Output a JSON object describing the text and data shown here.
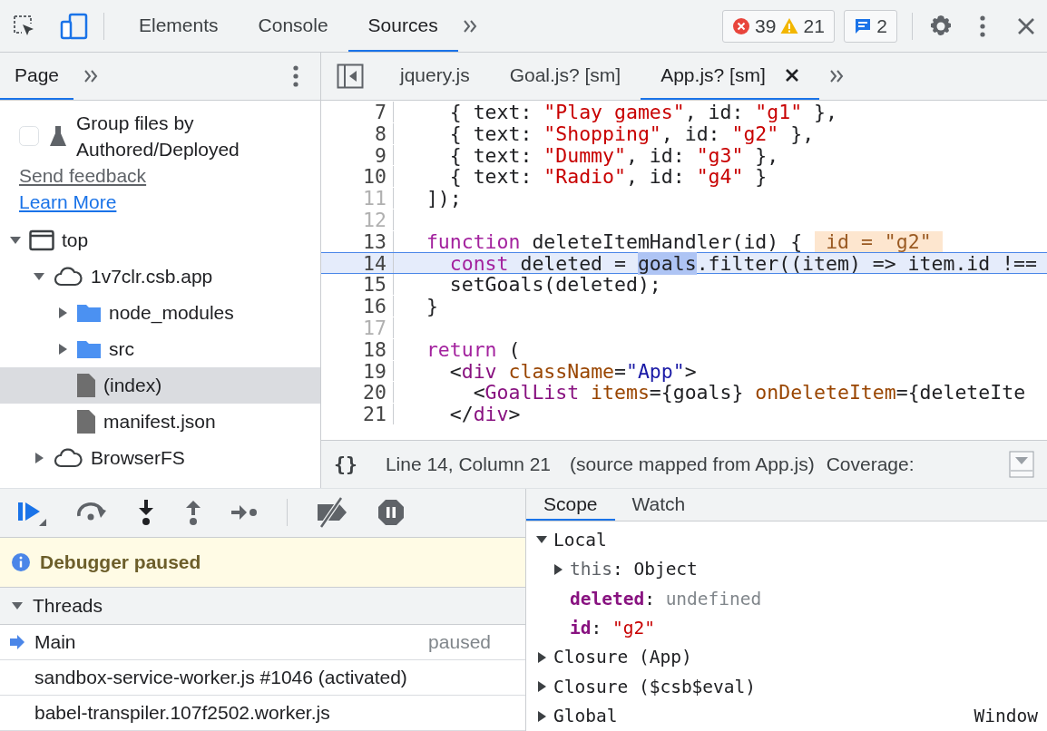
{
  "toolbar": {
    "tabs": [
      {
        "label": "Elements",
        "selected": false
      },
      {
        "label": "Console",
        "selected": false
      },
      {
        "label": "Sources",
        "selected": true
      }
    ],
    "errors": "39",
    "warnings": "21",
    "messages": "2"
  },
  "navigator": {
    "tabs": [
      {
        "label": "Page",
        "selected": true
      }
    ],
    "group_files": {
      "label": "Group files by Authored/Deployed",
      "checked": false
    },
    "send_feedback": "Send feedback",
    "learn_more": "Learn More",
    "tree": [
      {
        "kind": "frame",
        "label": "top",
        "expanded": true,
        "selected": false,
        "children": [
          {
            "kind": "cloud",
            "label": "1v7clr.csb.app",
            "expanded": true,
            "selected": false,
            "children": [
              {
                "kind": "folder",
                "label": "node_modules",
                "expanded": false,
                "selected": false
              },
              {
                "kind": "folder",
                "label": "src",
                "expanded": false,
                "selected": false
              },
              {
                "kind": "file",
                "label": "(index)",
                "selected": true
              },
              {
                "kind": "file",
                "label": "manifest.json",
                "selected": false
              }
            ]
          },
          {
            "kind": "cloud",
            "label": "BrowserFS",
            "expanded": false,
            "selected": false
          }
        ]
      }
    ]
  },
  "editor": {
    "tabs": [
      {
        "label": "jquery.js",
        "selected": false
      },
      {
        "label": "Goal.js? [sm]",
        "selected": false
      },
      {
        "label": "App.js? [sm]",
        "selected": true
      }
    ],
    "lines": [
      {
        "number": "7",
        "dimmed": false,
        "current": false,
        "tokens": [
          {
            "kind": "plain",
            "text": "    { text: "
          },
          {
            "kind": "string",
            "text": "\"Play games\""
          },
          {
            "kind": "plain",
            "text": ", id: "
          },
          {
            "kind": "string",
            "text": "\"g1\""
          },
          {
            "kind": "plain",
            "text": " },"
          }
        ]
      },
      {
        "number": "8",
        "dimmed": false,
        "current": false,
        "tokens": [
          {
            "kind": "plain",
            "text": "    { text: "
          },
          {
            "kind": "string",
            "text": "\"Shopping\""
          },
          {
            "kind": "plain",
            "text": ", id: "
          },
          {
            "kind": "string",
            "text": "\"g2\""
          },
          {
            "kind": "plain",
            "text": " },"
          }
        ]
      },
      {
        "number": "9",
        "dimmed": false,
        "current": false,
        "tokens": [
          {
            "kind": "plain",
            "text": "    { text: "
          },
          {
            "kind": "string",
            "text": "\"Dummy\""
          },
          {
            "kind": "plain",
            "text": ", id: "
          },
          {
            "kind": "string",
            "text": "\"g3\""
          },
          {
            "kind": "plain",
            "text": " },"
          }
        ]
      },
      {
        "number": "10",
        "dimmed": false,
        "current": false,
        "tokens": [
          {
            "kind": "plain",
            "text": "    { text: "
          },
          {
            "kind": "string",
            "text": "\"Radio\""
          },
          {
            "kind": "plain",
            "text": ", id: "
          },
          {
            "kind": "string",
            "text": "\"g4\""
          },
          {
            "kind": "plain",
            "text": " }"
          }
        ]
      },
      {
        "number": "11",
        "dimmed": true,
        "current": false,
        "tokens": [
          {
            "kind": "plain",
            "text": "  ]);"
          }
        ]
      },
      {
        "number": "12",
        "dimmed": true,
        "current": false
      },
      {
        "number": "13",
        "dimmed": false,
        "current": false,
        "tokens": [
          {
            "kind": "keyword",
            "text": "  function"
          },
          {
            "kind": "plain",
            "text": " deleteItemHandler(id) {"
          }
        ],
        "inline_value": "id = \"g2\""
      },
      {
        "number": "14",
        "dimmed": false,
        "current": true,
        "tokens": [
          {
            "kind": "keyword",
            "text": "    const"
          },
          {
            "kind": "plain",
            "text": " deleted = "
          },
          {
            "kind": "match",
            "text": "goals"
          },
          {
            "kind": "plain",
            "text": ".filter((item) => item.id !=="
          }
        ]
      },
      {
        "number": "15",
        "dimmed": false,
        "current": false,
        "tokens": [
          {
            "kind": "plain",
            "text": "    setGoals(deleted);"
          }
        ]
      },
      {
        "number": "16",
        "dimmed": false,
        "current": false,
        "tokens": [
          {
            "kind": "plain",
            "text": "  }"
          }
        ]
      },
      {
        "number": "17",
        "dimmed": true,
        "current": false
      },
      {
        "number": "18",
        "dimmed": false,
        "current": false,
        "tokens": [
          {
            "kind": "keyword",
            "text": "  return"
          },
          {
            "kind": "plain",
            "text": " ("
          }
        ]
      },
      {
        "number": "19",
        "dimmed": false,
        "current": false,
        "tokens": [
          {
            "kind": "plain",
            "text": "    <"
          },
          {
            "kind": "tag",
            "text": "div"
          },
          {
            "kind": "attr",
            "text": " className"
          },
          {
            "kind": "plain",
            "text": "="
          },
          {
            "kind": "attrvalue",
            "text": "\"App\""
          },
          {
            "kind": "plain",
            "text": ">"
          }
        ]
      },
      {
        "number": "20",
        "dimmed": false,
        "current": false,
        "tokens": [
          {
            "kind": "plain",
            "text": "      <"
          },
          {
            "kind": "tag",
            "text": "GoalList"
          },
          {
            "kind": "attr",
            "text": " items"
          },
          {
            "kind": "plain",
            "text": "={goals} "
          },
          {
            "kind": "attr",
            "text": "onDeleteItem"
          },
          {
            "kind": "plain",
            "text": "={deleteIte"
          }
        ]
      },
      {
        "number": "21",
        "dimmed": false,
        "current": false,
        "tokens": [
          {
            "kind": "plain",
            "text": "    </"
          },
          {
            "kind": "tag",
            "text": "div"
          },
          {
            "kind": "plain",
            "text": ">"
          }
        ]
      }
    ],
    "status": {
      "format_button": "{}",
      "position": "Line 14, Column 21",
      "mapped_prefix": "(source mapped from ",
      "mapped_link": "App.js",
      "mapped_suffix": ")",
      "coverage": "Coverage:"
    }
  },
  "debugger": {
    "banner": "Debugger paused",
    "threads": {
      "title": "Threads",
      "expanded": true,
      "items": [
        {
          "name": "Main",
          "status": "paused",
          "current": true
        },
        {
          "name": "sandbox-service-worker.js #1046 (activated)",
          "current": false
        },
        {
          "name": "babel-transpiler.107f2502.worker.js",
          "current": false
        }
      ]
    }
  },
  "sidebar": {
    "tabs": [
      {
        "label": "Scope",
        "selected": true
      },
      {
        "label": "Watch",
        "selected": false
      }
    ],
    "scopes": [
      {
        "label": "Local",
        "expanded": true,
        "children": [
          {
            "name": "this",
            "separator": ":",
            "value": "Object",
            "kind": "object",
            "declared": false,
            "expanded": false
          },
          {
            "name": "deleted",
            "separator": ":",
            "value": "undefined",
            "kind": "undefined",
            "declared": true
          },
          {
            "name": "id",
            "separator": ":",
            "value": "\"g2\"",
            "kind": "string",
            "declared": true
          }
        ]
      },
      {
        "label": "Closure (App)",
        "expanded": false
      },
      {
        "label": "Closure ($csb$eval)",
        "expanded": false
      },
      {
        "label": "Global",
        "value": "Window",
        "expanded": false
      }
    ]
  }
}
